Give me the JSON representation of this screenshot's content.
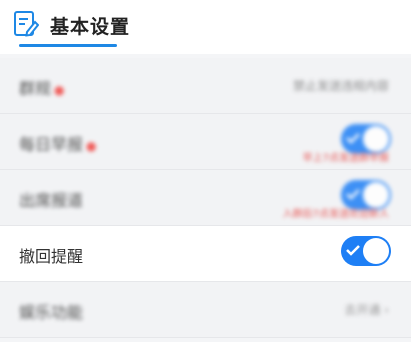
{
  "header": {
    "title": "基本设置",
    "icon": "edit-document-icon",
    "accent": "#1e88e5"
  },
  "rows": [
    {
      "label": "群规",
      "required": true,
      "value": "禁止发送违规内容"
    },
    {
      "label": "每日早报",
      "required": true,
      "toggle_on": true,
      "note": "早上7点发送群早报"
    },
    {
      "label": "出席报道",
      "required": false,
      "toggle_on": true,
      "note": "入群后7点发送欢迎新人"
    },
    {
      "label": "撤回提醒",
      "required": false,
      "toggle_on": true
    },
    {
      "label": "娱乐功能",
      "required": false,
      "link": "去开通"
    }
  ],
  "colors": {
    "toggle": "#1e7ff5",
    "required": "#f0403c"
  }
}
